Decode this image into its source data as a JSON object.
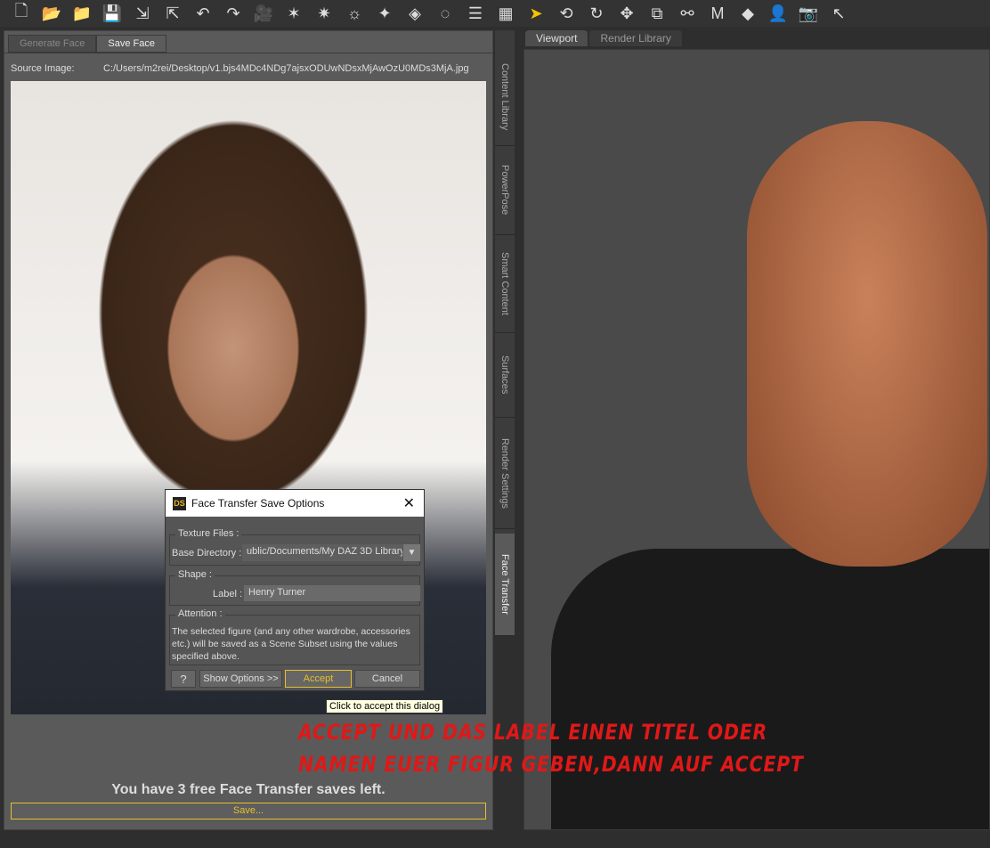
{
  "toolbar": {
    "icons": [
      "new-file",
      "open",
      "open-recent",
      "save",
      "import",
      "export",
      "undo",
      "redo",
      "camera",
      "light-spot",
      "light-point",
      "light-distant",
      "light-linear",
      "spotlight-add",
      "node-select",
      "align",
      "render",
      "select",
      "universal-tool",
      "rotate",
      "translate",
      "scale",
      "joint-editor",
      "morph",
      "surface-selector",
      "figure",
      "camera-render",
      "pointer"
    ]
  },
  "left_panel": {
    "tabs": [
      {
        "label": "Generate Face",
        "active": false
      },
      {
        "label": "Save Face",
        "active": true
      }
    ],
    "source_label": "Source Image:",
    "source_path": "C:/Users/m2rei/Desktop/v1.bjs4MDc4NDg7ajsxODUwNDsxMjAwOzU0MDs3MjA.jpg",
    "notice": "You have 3 free Face Transfer saves left.",
    "save_button": "Save..."
  },
  "side_tabs": [
    "Content Library",
    "PowerPose",
    "Smart Content",
    "Surfaces",
    "Render Settings",
    "Face Transfer"
  ],
  "viewport": {
    "tabs": [
      {
        "label": "Viewport",
        "active": true
      },
      {
        "label": "Render Library",
        "active": false
      }
    ]
  },
  "dialog": {
    "title": "Face Transfer Save Options",
    "logo": "DS",
    "texture_group": "Texture Files :",
    "base_dir_label": "Base Directory :",
    "base_dir_value": "ublic/Documents/My DAZ 3D Library",
    "shape_group": "Shape :",
    "label_label": "Label :",
    "label_value": "Henry Turner",
    "attention_group": "Attention :",
    "attention_text": "The selected figure (and any other wardrobe, accessories etc.) will be saved as a Scene Subset using the values specified above.",
    "show_options": "Show Options >>",
    "accept": "Accept",
    "cancel": "Cancel",
    "tooltip": "Click to accept this dialog"
  },
  "annotation": {
    "line1": "Accept und das Label einen Titel oder",
    "line2": "Namen euer Figur geben,dann auf Accept"
  },
  "colors": {
    "accent": "#e6c12a",
    "annotation": "#e01818"
  }
}
